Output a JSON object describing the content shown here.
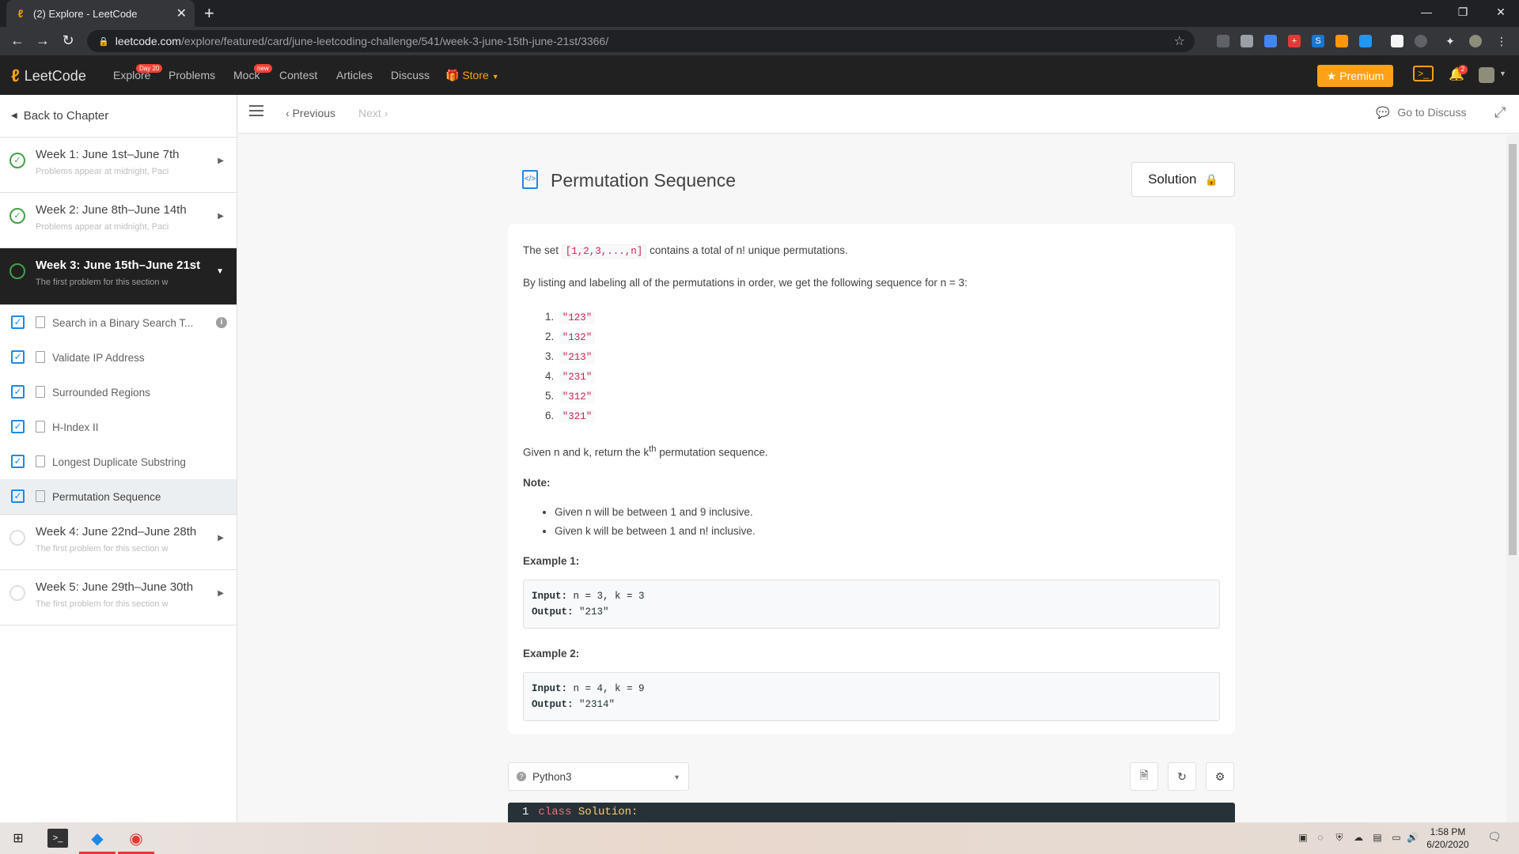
{
  "browser": {
    "tab_title": "(2) Explore - LeetCode",
    "url_host": "leetcode.com",
    "url_path": "/explore/featured/card/june-leetcoding-challenge/541/week-3-june-15th-june-21st/3366/"
  },
  "navbar": {
    "logo": "LeetCode",
    "links": {
      "explore": "Explore",
      "explore_badge": "Day 20",
      "problems": "Problems",
      "mock": "Mock",
      "mock_badge": "new",
      "contest": "Contest",
      "articles": "Articles",
      "discuss": "Discuss",
      "store": "Store"
    },
    "premium": "Premium",
    "notifications": "2"
  },
  "sidebar": {
    "back": "Back to Chapter",
    "weeks_before": [
      {
        "title": "Week 1: June 1st–June 7th",
        "subtitle": "Problems appear at midnight, Paci"
      },
      {
        "title": "Week 2: June 8th–June 14th",
        "subtitle": "Problems appear at midnight, Paci"
      }
    ],
    "active_week": {
      "title": "Week 3: June 15th–June 21st",
      "subtitle": "The first problem for this section w"
    },
    "items": [
      {
        "label": "Search in a Binary Search T..."
      },
      {
        "label": "Validate IP Address"
      },
      {
        "label": "Surrounded Regions"
      },
      {
        "label": "H-Index II"
      },
      {
        "label": "Longest Duplicate Substring"
      },
      {
        "label": "Permutation Sequence"
      }
    ],
    "weeks_after": [
      {
        "title": "Week 4: June 22nd–June 28th",
        "subtitle": "The first problem for this section w"
      },
      {
        "title": "Week 5: June 29th–June 30th",
        "subtitle": "The first problem for this section w"
      }
    ]
  },
  "toolbar": {
    "previous": "Previous",
    "next": "Next",
    "go_to_discuss": "Go to Discuss"
  },
  "question": {
    "title": "Permutation Sequence",
    "solution_button": "Solution",
    "intro_prefix": "The set",
    "set_code": "[1,2,3,...,n]",
    "intro_suffix": "contains a total of n! unique permutations.",
    "listing_text": "By listing and labeling all of the permutations in order, we get the following sequence for n = 3:",
    "permutations": [
      "\"123\"",
      "\"132\"",
      "\"213\"",
      "\"231\"",
      "\"312\"",
      "\"321\""
    ],
    "task_prefix": "Given n and k, return the k",
    "task_sup": "th",
    "task_suffix": "permutation sequence.",
    "note_heading": "Note:",
    "notes": [
      "Given n will be between 1 and 9 inclusive.",
      "Given k will be between 1 and n! inclusive."
    ],
    "examples": [
      {
        "heading": "Example 1:",
        "input_label": "Input:",
        "input": "n = 3, k = 3",
        "output_label": "Output:",
        "output": "\"213\""
      },
      {
        "heading": "Example 2:",
        "input_label": "Input:",
        "input": "n = 4, k = 9",
        "output_label": "Output:",
        "output": "\"2314\""
      }
    ]
  },
  "editor": {
    "language": "Python3",
    "line_number": "1",
    "code_keyword": "class",
    "code_class": "Solution:"
  },
  "taskbar": {
    "time": "1:58 PM",
    "date": "6/20/2020"
  },
  "colors": {
    "accent": "#ffa116",
    "check_blue": "#1e88e5",
    "complete_green": "#43a047",
    "navbar_bg": "#212121"
  }
}
